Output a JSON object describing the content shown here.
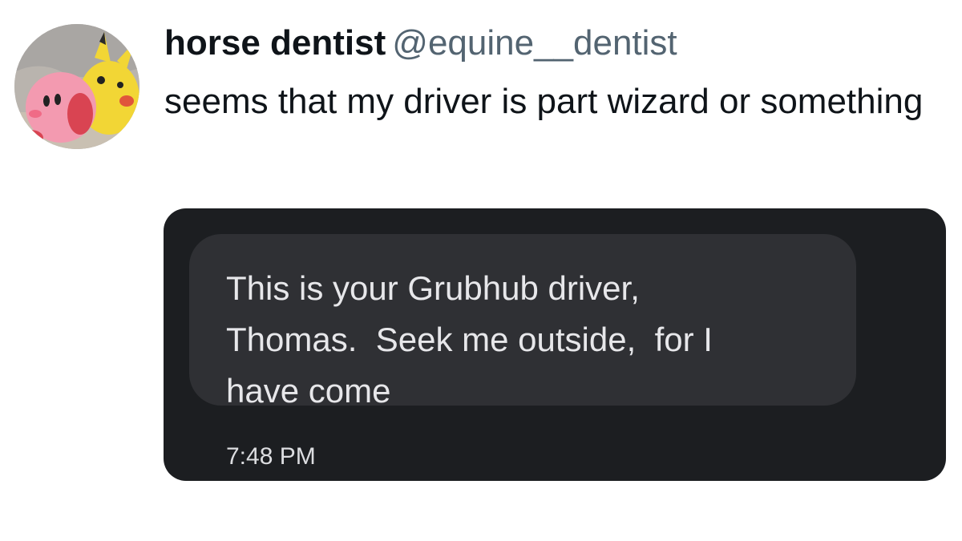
{
  "tweet": {
    "author": {
      "display_name": "horse dentist",
      "handle": "@equine__dentist"
    },
    "text": "seems that my driver is part wizard or something"
  },
  "attached_message": {
    "lines": [
      "This is your Grubhub driver,",
      "Thomas.  Seek me outside,  for I",
      "have come"
    ],
    "timestamp": "7:48 PM"
  }
}
